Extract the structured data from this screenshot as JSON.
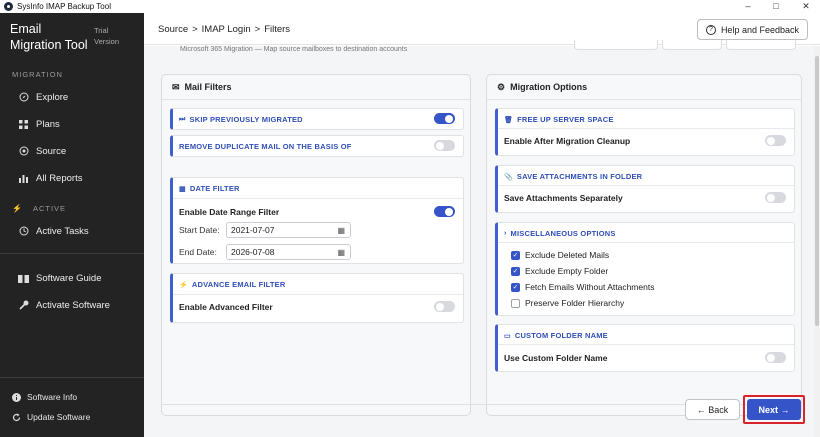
{
  "window": {
    "title": "SysInfo IMAP Backup Tool",
    "minimize": "‒",
    "maximize": "□",
    "close": "✕"
  },
  "sidebar": {
    "brand": "Email Migration Tool",
    "trial": "Trial Version",
    "section_migration": "MIGRATION",
    "items": [
      {
        "label": "Explore",
        "icon": "compass-icon"
      },
      {
        "label": "Plans",
        "icon": "grid-icon"
      },
      {
        "label": "Source",
        "icon": "target-icon"
      },
      {
        "label": "All Reports",
        "icon": "chart-icon"
      }
    ],
    "section_active": "ACTIVE",
    "active_tasks": "Active Tasks",
    "software_guide": "Software Guide",
    "activate_software": "Activate Software",
    "software_info": "Software Info",
    "update_software": "Update Software"
  },
  "breadcrumb": [
    "Source",
    ">",
    "IMAP Login",
    ">",
    "Filters"
  ],
  "help_button": "Help and Feedback",
  "subtitle": "Microsoft 365 Migration — Map source mailboxes to destination accounts",
  "mail_filters": {
    "title": "Mail Filters",
    "skip_migrated": {
      "title": "SKIP PREVIOUSLY MIGRATED",
      "on": true
    },
    "remove_duplicate": {
      "title": "REMOVE DUPLICATE MAIL ON THE BASIS OF",
      "on": false
    },
    "date_filter": {
      "title": "DATE FILTER",
      "enable_label": "Enable Date Range Filter",
      "on": true,
      "start_label": "Start Date:",
      "start_value": "2021-07-07",
      "end_label": "End Date:",
      "end_value": "2026-07-08"
    },
    "advance_filter": {
      "title": "ADVANCE EMAIL FILTER",
      "enable_label": "Enable Advanced Filter",
      "on": false
    }
  },
  "migration_options": {
    "title": "Migration Options",
    "free_up": {
      "title": "FREE UP SERVER SPACE",
      "label": "Enable After Migration Cleanup",
      "on": false
    },
    "save_attachments": {
      "title": "SAVE ATTACHMENTS IN FOLDER",
      "label": "Save Attachments Separately",
      "on": false
    },
    "misc": {
      "title": "MISCELLANEOUS OPTIONS",
      "options": [
        {
          "label": "Exclude Deleted Mails",
          "checked": true
        },
        {
          "label": "Exclude Empty Folder",
          "checked": true
        },
        {
          "label": "Fetch Emails Without Attachments",
          "checked": true
        },
        {
          "label": "Preserve Folder Hierarchy",
          "checked": false
        }
      ]
    },
    "custom_folder": {
      "title": "CUSTOM FOLDER NAME",
      "label": "Use Custom Folder Name",
      "on": false
    }
  },
  "footer": {
    "back": "← Back",
    "next": "Next →"
  },
  "colors": {
    "accent": "#3454c7",
    "sidebar": "#232323",
    "highlight": "#d8232a"
  }
}
